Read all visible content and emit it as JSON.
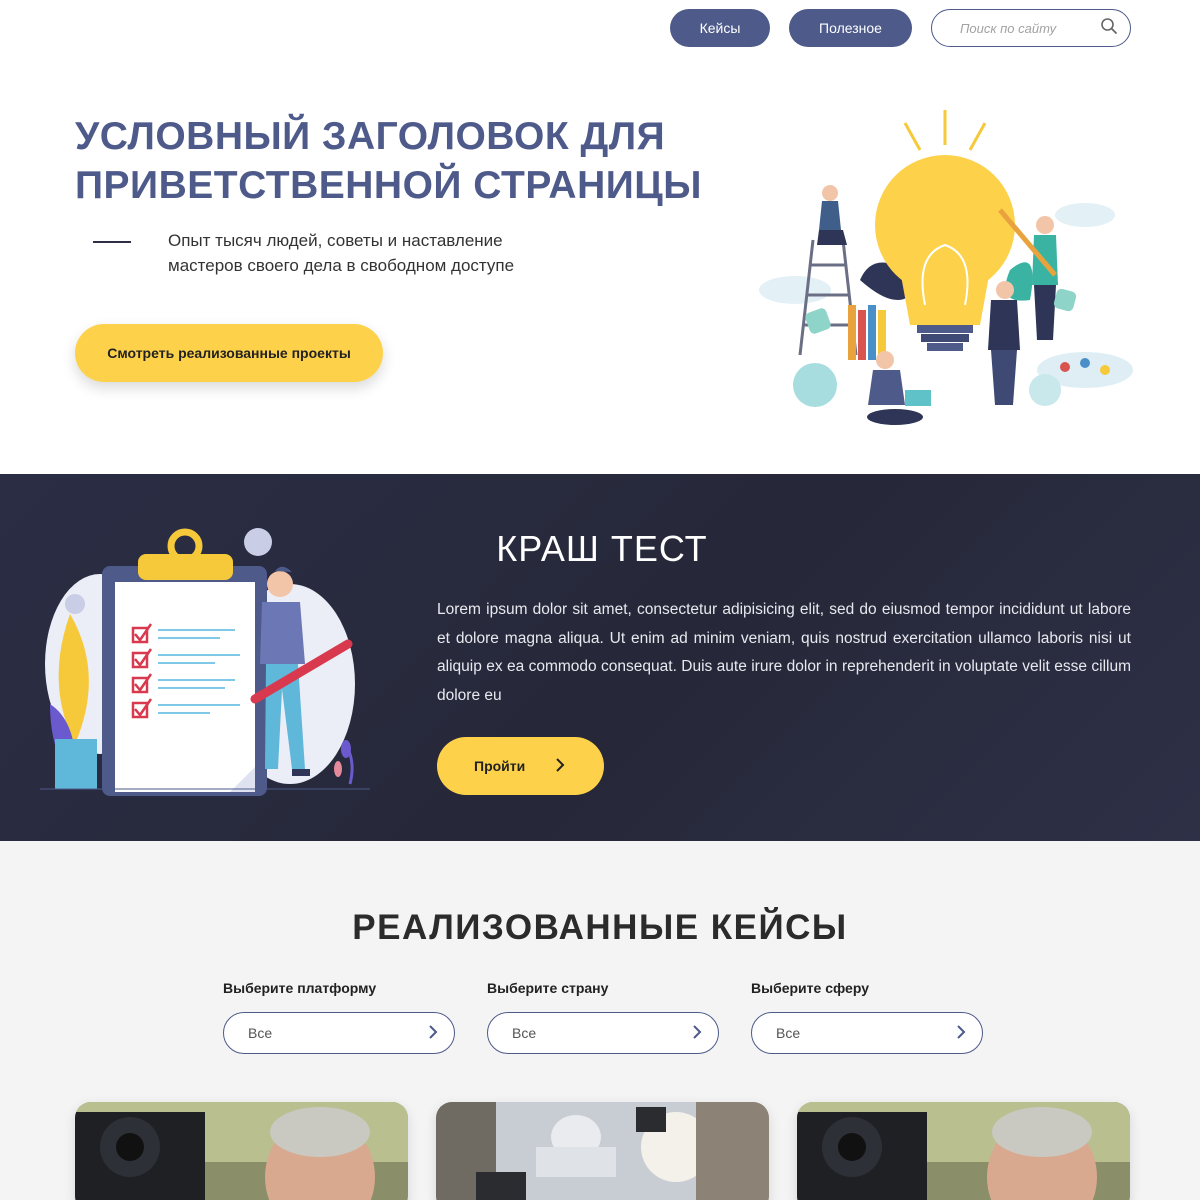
{
  "header": {
    "nav": [
      {
        "label": "Кейсы"
      },
      {
        "label": "Полезное"
      }
    ],
    "search": {
      "placeholder": "Поиск по сайту"
    }
  },
  "hero": {
    "title_lines": [
      "УСЛОВНЫЙ ЗАГОЛОВОК ДЛЯ",
      "ПРИВЕТСТВЕННОЙ СТРАНИЦЫ"
    ],
    "subtitle_lines": [
      "Опыт тысяч людей, советы и наставление",
      "мастеров своего дела в свободном доступе"
    ],
    "cta_label": "Смотреть реализованные проекты"
  },
  "crash_test": {
    "title": "КРАШ ТЕСТ",
    "text": "Lorem ipsum dolor sit amet, consectetur adipisicing elit, sed do eiusmod tempor incididunt ut labore et dolore magna aliqua. Ut enim ad minim veniam, quis nostrud exercitation ullamco laboris nisi ut aliquip ex ea commodo consequat. Duis aute irure dolor in reprehenderit in voluptate velit esse cillum dolore eu",
    "button_label": "Пройти"
  },
  "cases": {
    "title": "РЕАЛИЗОВАННЫЕ КЕЙСЫ",
    "filters": [
      {
        "label": "Выберите платформу",
        "value": "Все"
      },
      {
        "label": "Выберите страну",
        "value": "Все"
      },
      {
        "label": "Выберите сферу",
        "value": "Все"
      }
    ],
    "cards": [
      {
        "image": "camera-operator-photo"
      },
      {
        "image": "capitol-press-photo"
      },
      {
        "image": "camera-operator-photo"
      }
    ]
  },
  "colors": {
    "accent": "#4d5a8a",
    "cta": "#fdd24a",
    "dark_band": "#2b2d45",
    "section_bg": "#f4f4f4"
  }
}
